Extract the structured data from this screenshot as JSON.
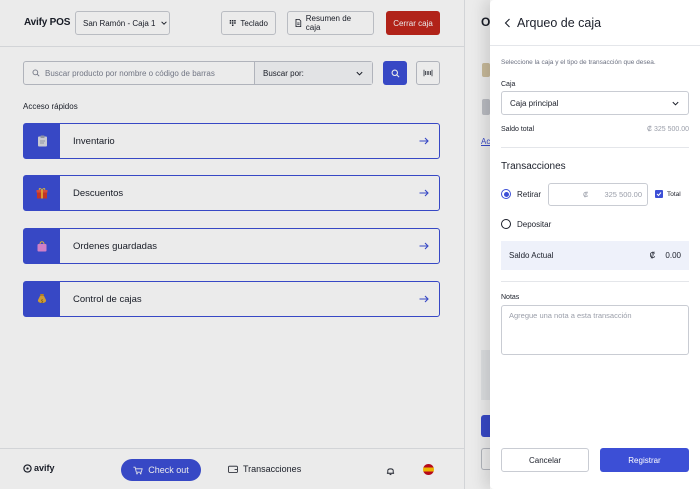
{
  "header": {
    "brand": "Avify POS",
    "store": "San Ramón - Caja 1",
    "keyboard_label": "Teclado",
    "summary_label": "Resumen de caja",
    "close_label": "Cerrar caja"
  },
  "search": {
    "placeholder": "Buscar producto por nombre o código de barras",
    "by_label": "Buscar por:"
  },
  "quick_access": {
    "title": "Acceso rápidos",
    "items": [
      {
        "label": "Inventario",
        "icon": "clipboard-icon"
      },
      {
        "label": "Descuentos",
        "icon": "gift-icon"
      },
      {
        "label": "Ordenes guardadas",
        "icon": "shopping-bag-icon"
      },
      {
        "label": "Control de cajas",
        "icon": "money-bag-icon"
      }
    ]
  },
  "footer": {
    "logo": "avify",
    "checkout": "Check out",
    "transactions": "Transacciones"
  },
  "peek": {
    "title_letter": "O",
    "link_letters": "Ac"
  },
  "drawer": {
    "title": "Arqueo de caja",
    "subtitle": "Seleccione la caja y el tipo de transacción que desea.",
    "caja_label": "Caja",
    "caja_value": "Caja principal",
    "saldo_total_label": "Saldo total",
    "saldo_total_value": "₡   325 500.00",
    "transactions_title": "Transacciones",
    "retirar_label": "Retirar",
    "amount_currency": "₡",
    "amount_value": "325 500.00",
    "total_label": "Total",
    "depositar_label": "Depositar",
    "saldo_actual_label": "Saldo Actual",
    "saldo_actual_currency": "₡",
    "saldo_actual_value": "0.00",
    "notas_label": "Notas",
    "notas_placeholder": "Agregue una nota a esta transacción",
    "cancel_label": "Cancelar",
    "register_label": "Registrar"
  },
  "colors": {
    "accent": "#3c4fd6",
    "danger": "#c0261c"
  }
}
